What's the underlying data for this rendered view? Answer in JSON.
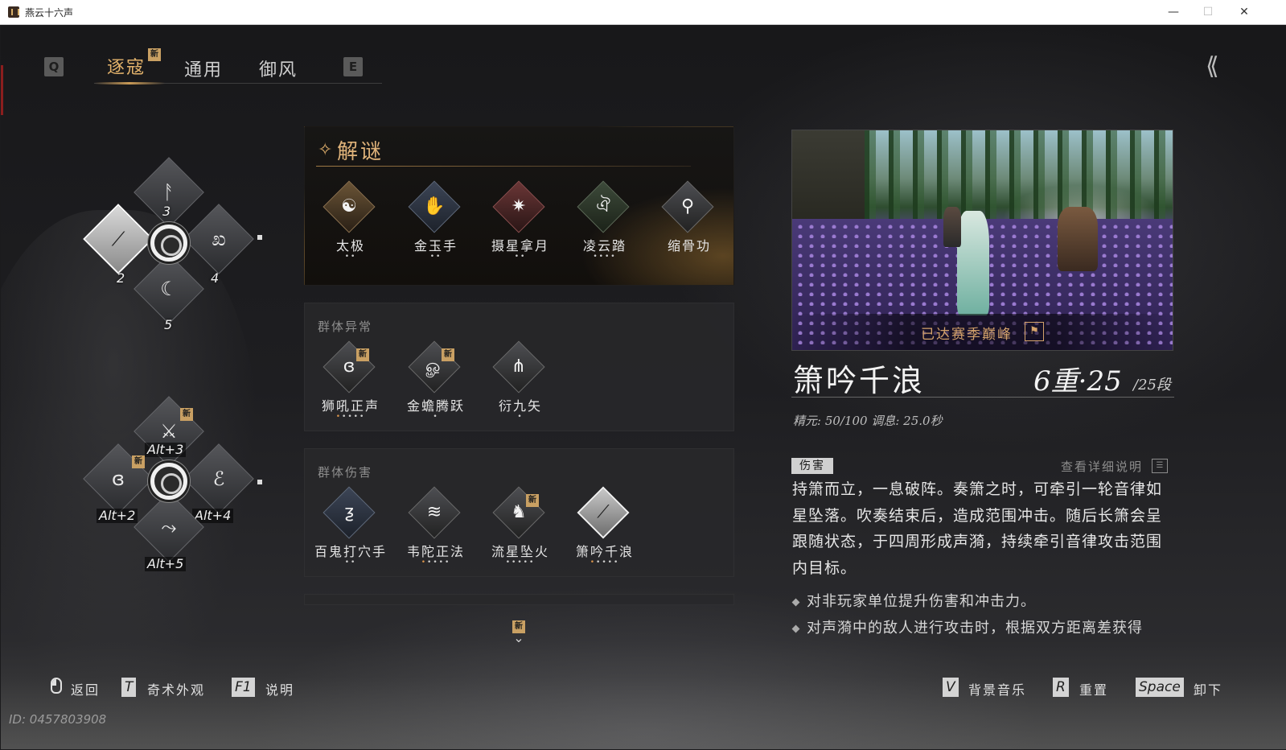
{
  "window": {
    "title": "燕云十六声",
    "minimize": "—",
    "maximize": "☐",
    "close": "✕"
  },
  "tabs": {
    "prev_key": "Q",
    "next_key": "E",
    "items": [
      {
        "label": "逐寇",
        "active": true,
        "badge": "新"
      },
      {
        "label": "通用",
        "active": false
      },
      {
        "label": "御风",
        "active": false
      }
    ]
  },
  "back_icon": "double-chevron-left-icon",
  "wheel1": {
    "slots": [
      {
        "num": "3",
        "icon": "figure-icon"
      },
      {
        "num": "2",
        "icon": "flute-icon",
        "selected": true
      },
      {
        "num": "4",
        "icon": "swirl-icon"
      },
      {
        "num": "5",
        "icon": "crescent-icon"
      }
    ]
  },
  "wheel2": {
    "slots": [
      {
        "num": "Alt+3",
        "icon": "leap-icon",
        "badge": "新"
      },
      {
        "num": "Alt+2",
        "icon": "shout-icon",
        "badge": "新"
      },
      {
        "num": "Alt+4",
        "icon": "meteor-icon"
      },
      {
        "num": "Alt+5",
        "icon": "staff-icon"
      }
    ]
  },
  "puzzle": {
    "title": "解谜",
    "skills": [
      {
        "name": "太极",
        "dots": "••",
        "icon": "taichi-icon",
        "color": "brown"
      },
      {
        "name": "金玉手",
        "dots": "••",
        "icon": "palm-icon",
        "color": "blue"
      },
      {
        "name": "摄星拿月",
        "dots": "••",
        "icon": "grasp-icon",
        "color": "red"
      },
      {
        "name": "凌云踏",
        "dots": "••••",
        "icon": "step-icon",
        "color": "green"
      },
      {
        "name": "缩骨功",
        "dots": "",
        "icon": "bone-icon",
        "color": "gray"
      }
    ]
  },
  "group_abnormal": {
    "title": "群体异常",
    "skills": [
      {
        "name": "狮吼正声",
        "dots_orange": "•",
        "dots": "••••",
        "icon": "lion-roar-icon",
        "badge": "新"
      },
      {
        "name": "金蟾腾跃",
        "dots_orange": "",
        "dots": "•",
        "icon": "toad-icon",
        "badge": "新"
      },
      {
        "name": "衍九矢",
        "dots_orange": "",
        "dots": "•",
        "icon": "arrows-icon",
        "badge": ""
      }
    ]
  },
  "group_damage": {
    "title": "群体伤害",
    "skills": [
      {
        "name": "百鬼打穴手",
        "dots_orange": "",
        "dots": "••",
        "icon": "ghost-palm-icon",
        "badge": ""
      },
      {
        "name": "韦陀正法",
        "dots_orange": "•",
        "dots": "••••",
        "icon": "dharma-icon",
        "badge": ""
      },
      {
        "name": "流星坠火",
        "dots_orange": "",
        "dots": "•••••",
        "icon": "meteor-fire-icon",
        "badge": "新"
      },
      {
        "name": "箫吟千浪",
        "dots_orange": "•",
        "dots": "••••",
        "icon": "flute-wave-icon",
        "badge": "",
        "selected": true
      }
    ]
  },
  "scroll_badge": "新",
  "detail": {
    "banner": "已达赛季巅峰",
    "name": "箫吟千浪",
    "level": "6重·25",
    "level_sub": "/25段",
    "stats": "精元: 50/100   调息: 25.0秒",
    "tag": "伤害",
    "detail_link": "查看详细说明",
    "desc": "持箫而立，一息破阵。奏箫之时，可牵引一轮音律如星坠落。吹奏结束后，造成范围冲击。随后长箫会呈跟随状态，于四周形成声漪，持续牵引音律攻击范围内目标。",
    "bullets": [
      "对非玩家单位提升伤害和冲击力。",
      "对声漪中的敌人进行攻击时，根据双方距离差获得"
    ]
  },
  "footer": {
    "left": [
      {
        "key": "mouse-icon",
        "label": "返回"
      },
      {
        "key": "T",
        "label": "奇术外观"
      },
      {
        "key": "F1",
        "label": "说明"
      }
    ],
    "right": [
      {
        "key": "V",
        "label": "背景音乐"
      },
      {
        "key": "R",
        "label": "重置"
      },
      {
        "key": "Space",
        "label": "卸下"
      }
    ],
    "id": "ID: 0457803908"
  }
}
